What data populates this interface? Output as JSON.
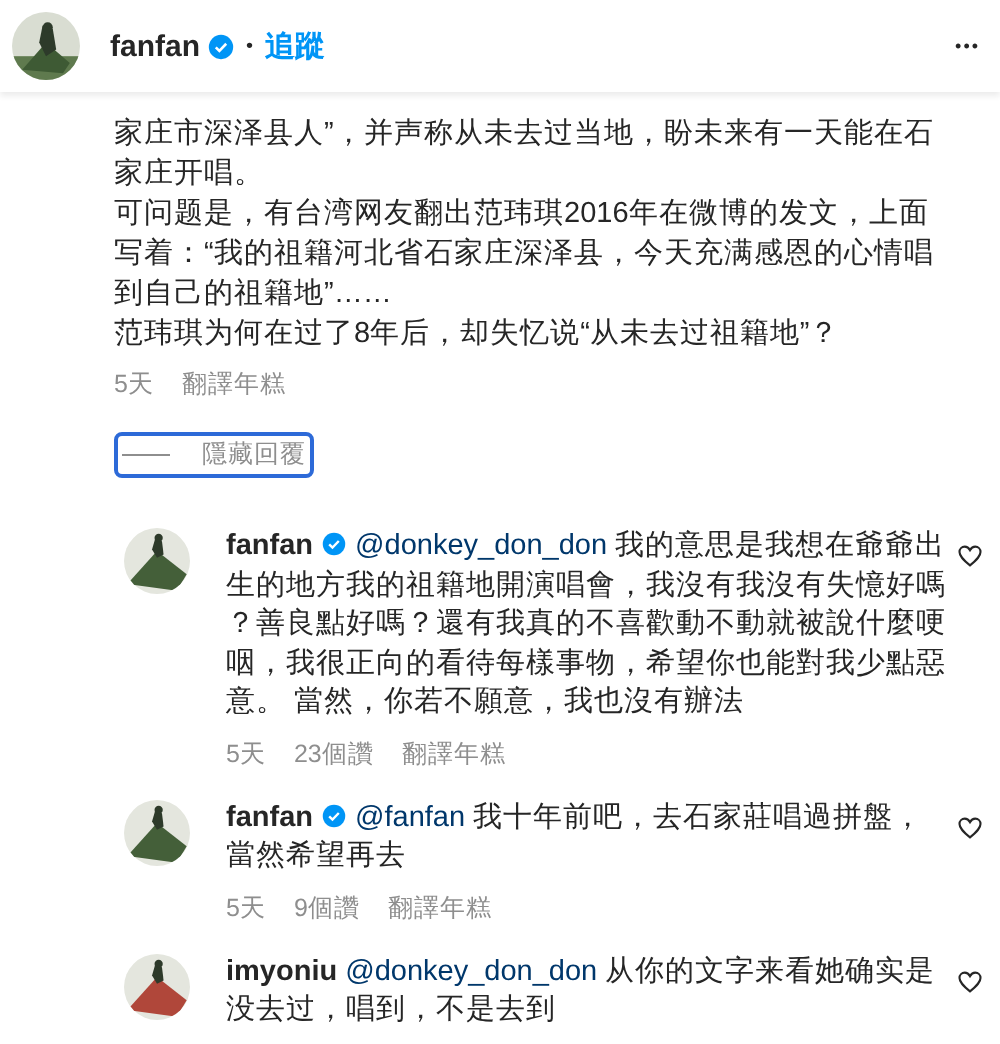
{
  "header": {
    "username": "fanfan",
    "verified": true,
    "separator": "•",
    "follow": "追蹤",
    "more": "•••"
  },
  "post": {
    "paragraphs": [
      "家庄市深泽县人”，并声称从未去过当地，盼未来有一天能在石家庄开唱。",
      "可问题是，有台湾网友翻出范玮琪2016年在微博的发文，上面写着：“我的祖籍河北省石家庄深泽县，今天充满感恩的心情唱到自己的祖籍地”……",
      "范玮琪为何在过了8年后，却失忆说“从未去过祖籍地”？"
    ],
    "meta": {
      "time": "5天",
      "translate": "翻譯年糕"
    }
  },
  "hide_replies": {
    "label": "隱藏回覆",
    "focused": true
  },
  "replies": [
    {
      "username": "fanfan",
      "verified": true,
      "mention": "@donkey_don_don",
      "text": " 我的意思是我想在爺爺出生的地方我的祖籍地開演唱會，我沒有我沒有失憶好嗎？善良點好嗎？還有我真的不喜歡動不動就被說什麼哽咽，我很正向的看待每樣事物，希望你也能對我少點惡意。 當然，你若不願意，我也沒有辦法",
      "time": "5天",
      "likes": "23個讚",
      "translate": "翻譯年糕",
      "liked": false,
      "color": "#445f39"
    },
    {
      "username": "fanfan",
      "verified": true,
      "mention": "@fanfan",
      "text": " 我十年前吧，去石家莊唱過拼盤，當然希望再去",
      "time": "5天",
      "likes": "9個讚",
      "translate": "翻譯年糕",
      "liked": false,
      "color": "#445f39"
    },
    {
      "username": "imyoniu",
      "verified": false,
      "mention": "@donkey_don_don",
      "text": " 从你的文字来看她确实是没去过，唱到，不是去到",
      "liked": false,
      "color": "#b0473a"
    }
  ]
}
